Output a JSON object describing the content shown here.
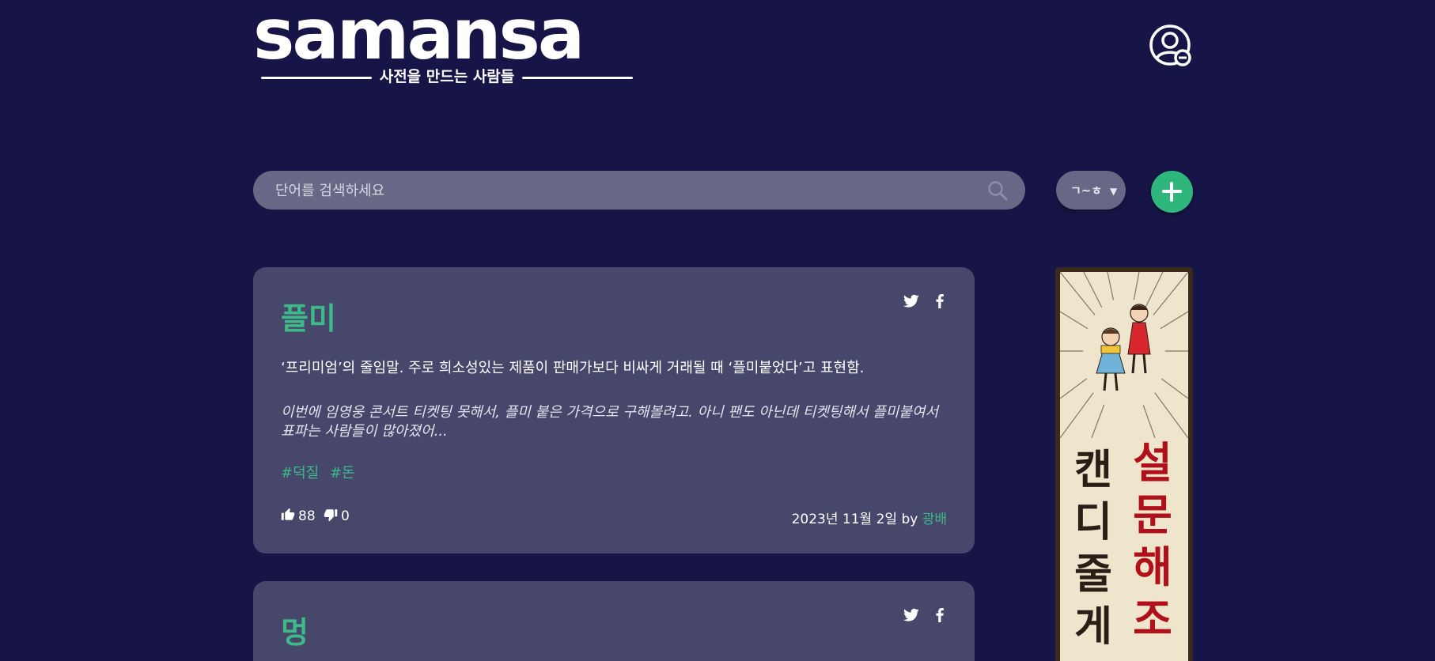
{
  "header": {
    "logo_word": "samansa",
    "logo_subtitle": "사전을 만드는 사람들"
  },
  "icons": {
    "profile": "user-minus-icon",
    "search": "search-icon",
    "add": "plus-icon",
    "like": "thumbs-up-icon",
    "dislike": "thumbs-down-icon",
    "twitter": "twitter-icon",
    "facebook": "facebook-icon"
  },
  "search": {
    "placeholder": "단어를 검색하세요"
  },
  "sort": {
    "label": "ㄱ~ㅎ",
    "caret": "▼"
  },
  "colors": {
    "background": "#171547",
    "card": "#47466b",
    "accent": "#3dba88",
    "add_button": "#2fb67c",
    "input": "#676885"
  },
  "entries": [
    {
      "word": "플미",
      "definition": "‘프리미엄’의 줄임말. 주로 희소성있는 제품이 판매가보다 비싸게 거래될 때 ‘플미붙었다’고 표현함.",
      "example": "이번에 임영웅 콘서트 티켓팅 못해서, 플미 붙은 가격으로 구해볼려고. 아니 팬도 아닌데 티켓팅해서 플미붙여서 표파는 사람들이 많아졌어...",
      "tags": [
        "#덕질",
        "#돈"
      ],
      "likes": "88",
      "dislikes": "0",
      "date": "2023년 11월 2일",
      "by": "by",
      "author": "광배"
    },
    {
      "word": "멍"
    }
  ],
  "ad": {
    "left_text": "캔디줄게",
    "right_text": "설문해조"
  }
}
